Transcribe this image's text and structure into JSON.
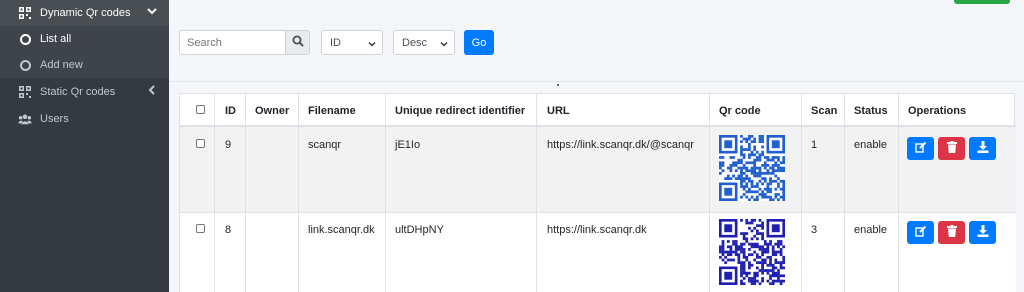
{
  "sidebar": {
    "items": [
      {
        "label": "Dynamic Qr codes"
      },
      {
        "label": "List all"
      },
      {
        "label": "Add new"
      },
      {
        "label": "Static Qr codes"
      },
      {
        "label": "Users"
      }
    ]
  },
  "toolbar": {
    "search_placeholder": "Search",
    "sort_field": "ID",
    "sort_order": "Desc",
    "go_label": "Go"
  },
  "table": {
    "headers": [
      "ID",
      "Owner",
      "Filename",
      "Unique redirect identifier",
      "URL",
      "Qr code",
      "Scan",
      "Status",
      "Operations"
    ],
    "rows": [
      {
        "id": "9",
        "owner": "",
        "filename": "scanqr",
        "identifier": "jE1Io",
        "url": "https://link.scanqr.dk/@scanqr",
        "scan": "1",
        "status": "enable"
      },
      {
        "id": "8",
        "owner": "",
        "filename": "link.scanqr.dk",
        "identifier": "ultDHpNY",
        "url": "https://link.scanqr.dk",
        "scan": "3",
        "status": "enable"
      }
    ]
  },
  "colors": {
    "sidebar_bg": "#343a40",
    "primary": "#007bff",
    "danger": "#dc3545",
    "success": "#28a745",
    "qr_row1": "#1f5fd0",
    "qr_row2": "#1f1fb0"
  },
  "icons": [
    "qrcode-icon",
    "chevron-down-icon",
    "circle-icon",
    "chevron-left-icon",
    "users-icon",
    "search-icon",
    "edit-icon",
    "trash-icon",
    "download-icon"
  ]
}
